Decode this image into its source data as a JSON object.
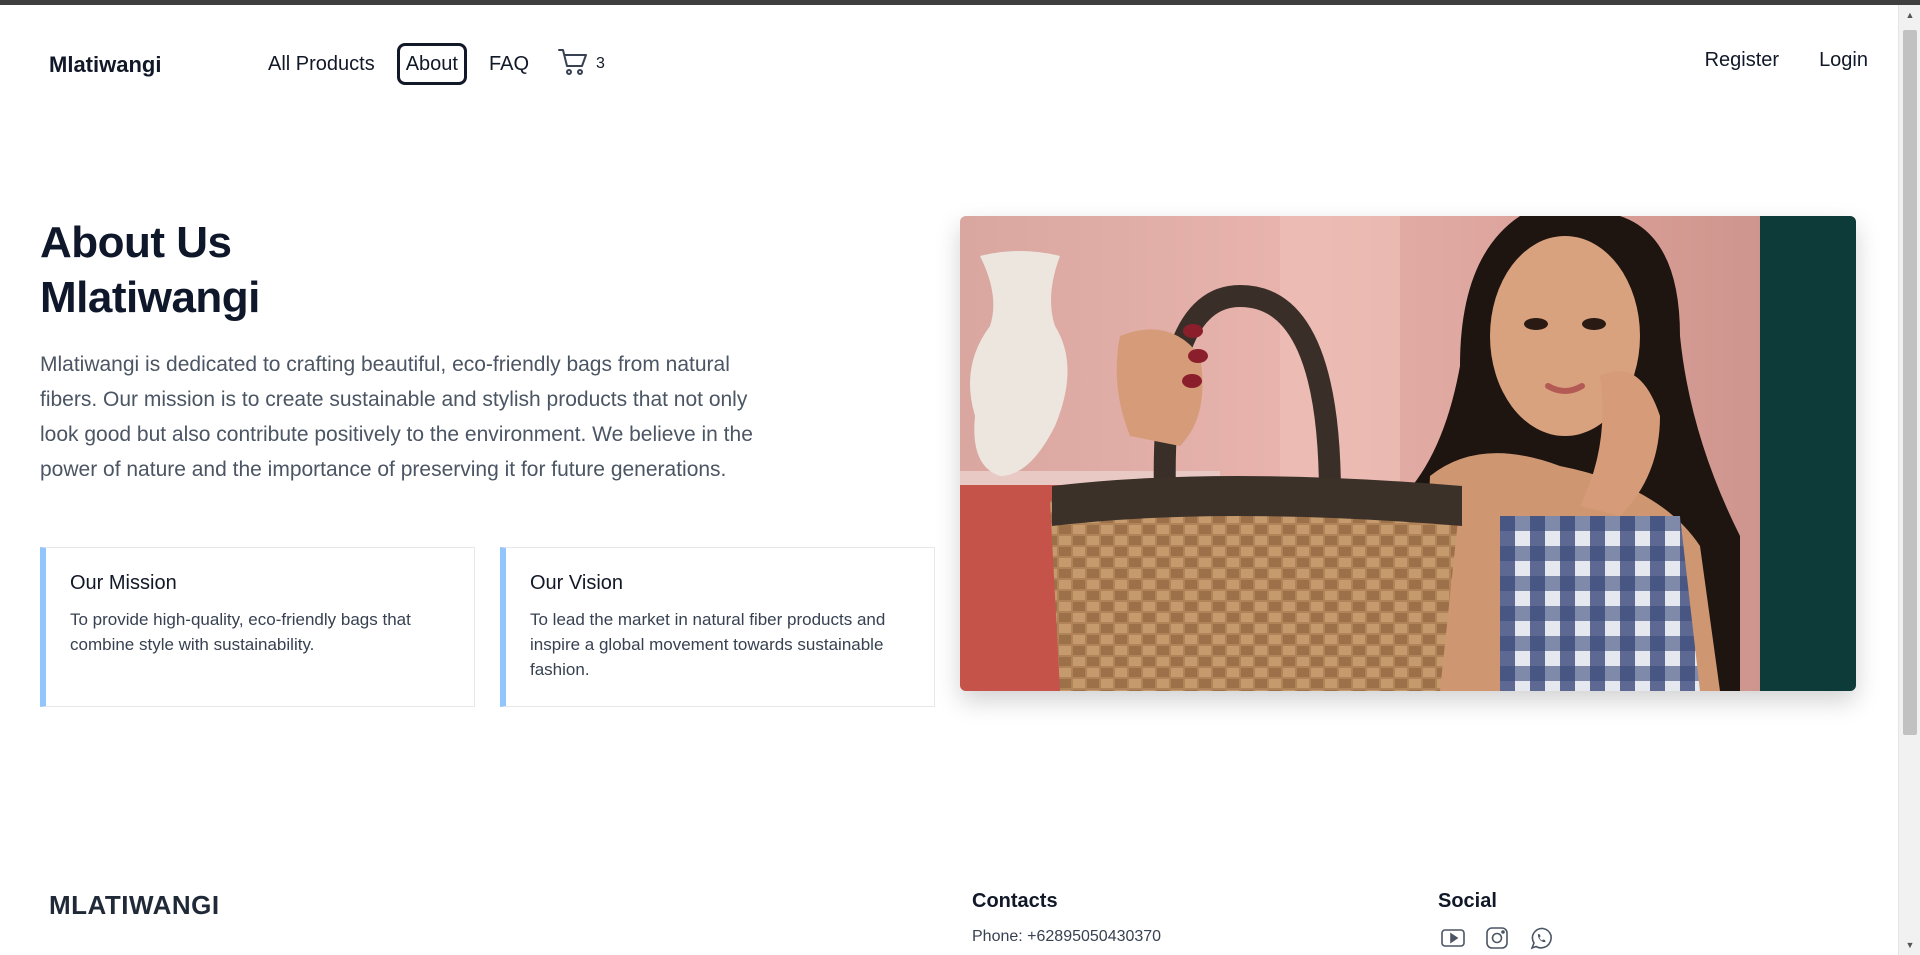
{
  "header": {
    "brand": "Mlatiwangi",
    "nav": [
      {
        "label": "All Products"
      },
      {
        "label": "About"
      },
      {
        "label": "FAQ"
      }
    ],
    "cart_count": "3",
    "register_label": "Register",
    "login_label": "Login"
  },
  "about": {
    "title_line1": "About Us",
    "title_line2": "Mlatiwangi",
    "description": "Mlatiwangi is dedicated to crafting beautiful, eco-friendly bags from natural fibers. Our mission is to create sustainable and stylish products that not only look good but also contribute positively to the environment. We believe in the power of nature and the importance of preserving it for future generations.",
    "mission": {
      "title": "Our Mission",
      "text": "To provide high-quality, eco-friendly bags that combine style with sustainability."
    },
    "vision": {
      "title": "Our Vision",
      "text": "To lead the market in natural fiber products and inspire a global movement towards sustainable fashion."
    }
  },
  "footer": {
    "brand": "MLATIWANGI",
    "contacts_title": "Contacts",
    "phone": "Phone: +62895050430370",
    "social_title": "Social",
    "social_icons": [
      "youtube-icon",
      "instagram-icon",
      "whatsapp-icon"
    ]
  },
  "colors": {
    "accent_border": "#93c5fd",
    "text_dark": "#111827",
    "text_muted": "#4b5563"
  }
}
